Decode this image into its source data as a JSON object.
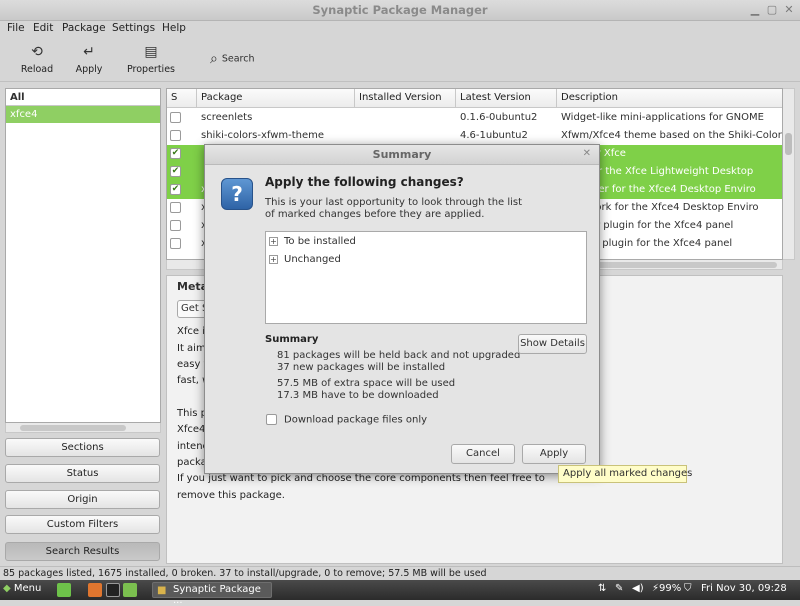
{
  "window": {
    "title": "Synaptic Package Manager"
  },
  "menubar": [
    "File",
    "Edit",
    "Package",
    "Settings",
    "Help"
  ],
  "toolbar": {
    "reload": "Reload",
    "apply": "Apply",
    "properties": "Properties",
    "search": "Search"
  },
  "sidebar": {
    "header": "All",
    "selected": "xfce4",
    "buttons": [
      "Sections",
      "Status",
      "Origin",
      "Custom Filters",
      "Search Results"
    ],
    "active_button": "Search Results"
  },
  "table": {
    "columns": [
      "S",
      "Package",
      "Installed Version",
      "Latest Version",
      "Description"
    ],
    "rows": [
      {
        "package": "screenlets",
        "installed": "",
        "latest": "0.1.6-0ubuntu2",
        "description": "Widget-like mini-applications for GNOME",
        "checked": false,
        "selected": false
      },
      {
        "package": "shiki-colors-xfwm-theme",
        "installed": "",
        "latest": "4.6-1ubuntu2",
        "description": "Xfwm/Xfce4 theme based on the Shiki-Colors M",
        "checked": false,
        "selected": false
      },
      {
        "package": "",
        "installed": "",
        "latest": "",
        "description": "ager for Xfce",
        "checked": true,
        "selected": true
      },
      {
        "package": "",
        "installed": "",
        "latest": "",
        "description": "kage for the Xfce Lightweight Desktop",
        "checked": true,
        "selected": true
      },
      {
        "package": "x",
        "installed": "",
        "latest": "",
        "description": "ion finder for the Xfce4 Desktop Enviro",
        "checked": true,
        "selected": true
      },
      {
        "package": "x",
        "installed": "",
        "latest": "",
        "description": "al artwork for the Xfce4 Desktop Enviro",
        "checked": false,
        "selected": false
      },
      {
        "package": "x",
        "installed": "",
        "latest": "",
        "description": "monitor plugin for the Xfce4 panel",
        "checked": false,
        "selected": false
      },
      {
        "package": "x",
        "installed": "",
        "latest": "",
        "description": "modem plugin for the Xfce4 panel",
        "checked": false,
        "selected": false
      }
    ]
  },
  "details": {
    "meta_tab": "Meta",
    "get_button": "Get S",
    "lines": [
      "Xfce is",
      "It aim",
      "easy t",
      "fast, w",
      "",
      "This p",
      "Xfce4",
      "intenc",
      "packa",
      "If you just want to pick and choose the core components then feel free to",
      "remove this package."
    ]
  },
  "status_bar": "85 packages listed, 1675 installed, 0 broken. 37 to install/upgrade, 0 to remove; 57.5 MB will be used",
  "taskbar": {
    "menu": "Menu",
    "task": "Synaptic Package ...",
    "battery": "99%",
    "clock": "Fri Nov 30, 09:28"
  },
  "dialog": {
    "title": "Summary",
    "heading": "Apply the following changes?",
    "intro_line1": "This is your last opportunity to look through the list",
    "intro_line2": "of marked changes before they are applied.",
    "tree": [
      "To be installed",
      "Unchanged"
    ],
    "summary_title": "Summary",
    "summary_lines": [
      "81 packages will be held back and not upgraded",
      "37 new packages will be installed",
      "57.5 MB of extra space will be used",
      "17.3 MB have to be downloaded"
    ],
    "show_details": "Show Details",
    "download_only": "Download package files only",
    "cancel": "Cancel",
    "apply": "Apply"
  },
  "tooltip": "Apply all marked changes",
  "colors": {
    "selection_green": "#7fd048",
    "sidebar_selection": "#8fcf63"
  }
}
